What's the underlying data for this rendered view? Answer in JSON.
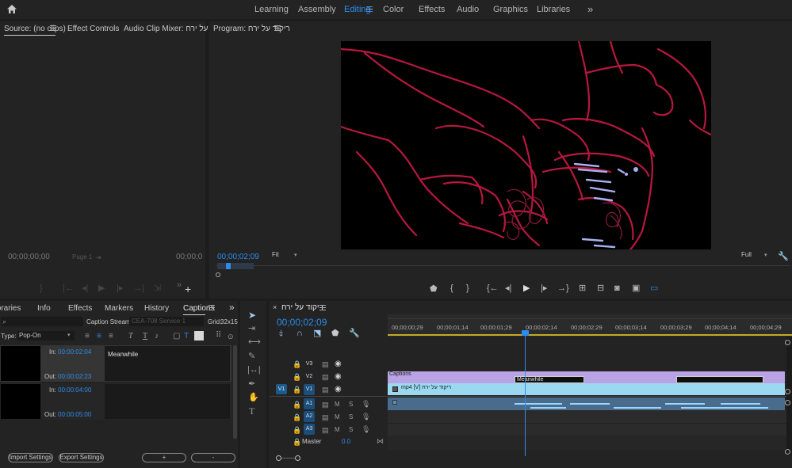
{
  "workspaces": [
    {
      "label": "Learning"
    },
    {
      "label": "Assembly"
    },
    {
      "label": "Editing"
    },
    {
      "label": "Color"
    },
    {
      "label": "Effects"
    },
    {
      "label": "Audio"
    },
    {
      "label": "Graphics"
    },
    {
      "label": "Libraries"
    }
  ],
  "source_panel": {
    "tab_source": "Source: (no clips)",
    "tab_effect_controls": "Effect Controls",
    "tab_audio_mixer": "Audio Clip Mixer: ריקוד על ירח",
    "timecode_left": "00;00;00;00",
    "page": "Page 1",
    "timecode_right": "00;00;0"
  },
  "program_panel": {
    "title": "Program: ריקוד על ירח",
    "timecode": "00;00;02;09",
    "fit": "Fit",
    "quality": "Full"
  },
  "captions_panel": {
    "tabs": [
      "Libraries",
      "Info",
      "Effects",
      "Markers",
      "History",
      "Captions"
    ],
    "caption_stream_label": "Caption Stream:",
    "caption_stream_value": "CEA-708 Service 1",
    "grid_label": "Grid:",
    "grid_value": "32x15",
    "type_label": "Type:",
    "type_value": "Pop-On",
    "captions": [
      {
        "in_label": "In:",
        "in": "00:00:02:04",
        "out_label": "Out:",
        "out": "00:00:02:23",
        "text": "Meanwhile"
      },
      {
        "in_label": "In:",
        "in": "00:00:04:00",
        "out_label": "Out:",
        "out": "00:00:05:00",
        "text": ""
      }
    ],
    "import_settings": "Import Settings",
    "export_settings": "Export Settings",
    "add": "+",
    "remove": "-"
  },
  "timeline": {
    "close": "×",
    "title": "ריקוד על ירח",
    "timecode": "00;00;02;09",
    "ruler_labels": [
      "00;00;00;29",
      "00;00;01;14",
      "00;00;01;29",
      "00;00;02;14",
      "00;00;02;29",
      "00;00;03;14",
      "00;00;03;29",
      "00;00;04;14",
      "00;00;04;29"
    ],
    "video_tracks": [
      {
        "label": "V3",
        "source": ""
      },
      {
        "label": "V2",
        "source": ""
      },
      {
        "label": "V1",
        "source": "V1"
      }
    ],
    "audio_tracks": [
      {
        "label": "A1",
        "m": "M",
        "s": "S"
      },
      {
        "label": "A2",
        "m": "M",
        "s": "S"
      },
      {
        "label": "A3",
        "m": "M",
        "s": "S"
      }
    ],
    "master_label": "Master",
    "master_value": "0.0",
    "captions_clip": "Captions",
    "caption_meanwhile": "Meanwhile",
    "video_clip": "mp4 [V] ריקוד על ירח"
  },
  "colors": {
    "accent": "#2d8ceb",
    "captions_clip": "#b9a3e4",
    "video_clip": "#9ad9f0",
    "audio_clip": "#4a6c8c",
    "line_art": "#b8173e"
  }
}
